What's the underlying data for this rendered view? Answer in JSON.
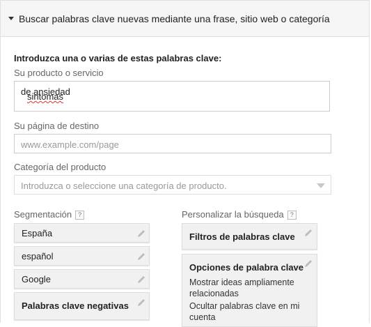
{
  "header": {
    "title": "Buscar palabras clave nuevas mediante una frase, sitio web o categoría"
  },
  "form": {
    "intro": "Introduzca una o varias de estas palabras clave:",
    "product_label": "Su producto o servicio",
    "product_value_word1": "sintomas",
    "product_value_rest": " de ansiedad",
    "landing_label": "Su página de destino",
    "landing_placeholder": "www.example.com/page",
    "category_label": "Categoría del producto",
    "category_placeholder": "Introduzca o seleccione una categoría de producto."
  },
  "targeting": {
    "label": "Segmentación",
    "help": "?",
    "items": [
      {
        "label": "España"
      },
      {
        "label": "español"
      },
      {
        "label": "Google"
      },
      {
        "label": "Palabras clave negativas"
      }
    ]
  },
  "customize": {
    "label": "Personalizar la búsqueda",
    "help": "?",
    "filters": "Filtros de palabras clave",
    "options_title": "Opciones de palabra clave",
    "option1": "Mostrar ideas ampliamente relacionadas",
    "option2": "Ocultar palabras clave en mi cuenta"
  }
}
